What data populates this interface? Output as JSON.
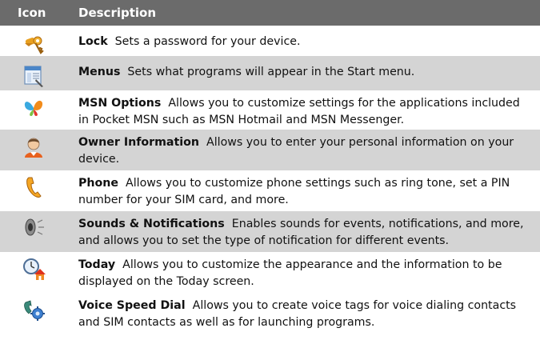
{
  "header": {
    "icon_col": "Icon",
    "desc_col": "Description"
  },
  "rows": [
    {
      "icon": "lock-keys-icon",
      "title": "Lock",
      "text": "Sets a password for your device."
    },
    {
      "icon": "menus-window-icon",
      "title": "Menus",
      "text": "Sets what programs will appear in the Start menu."
    },
    {
      "icon": "msn-butterfly-icon",
      "title": "MSN Options",
      "text": "Allows you to customize settings for the applications included in Pocket MSN such as MSN Hotmail and MSN Messenger."
    },
    {
      "icon": "owner-person-icon",
      "title": "Owner Information",
      "text": "Allows you to enter your personal information on your device."
    },
    {
      "icon": "phone-handset-icon",
      "title": "Phone",
      "text": "Allows you to customize phone settings such as ring tone, set a PIN number for your SIM card, and more."
    },
    {
      "icon": "speaker-sound-icon",
      "title": "Sounds & Notifications",
      "text": "Enables sounds for events, notifications, and more, and allows you to set the type of notification for different events."
    },
    {
      "icon": "today-clock-home-icon",
      "title": "Today",
      "text": "Allows you to customize the appearance and the information to be displayed on the Today screen."
    },
    {
      "icon": "voice-speed-dial-icon",
      "title": "Voice Speed Dial",
      "text": "Allows you to create voice tags for voice dialing contacts and SIM contacts as well as for launching programs."
    }
  ]
}
